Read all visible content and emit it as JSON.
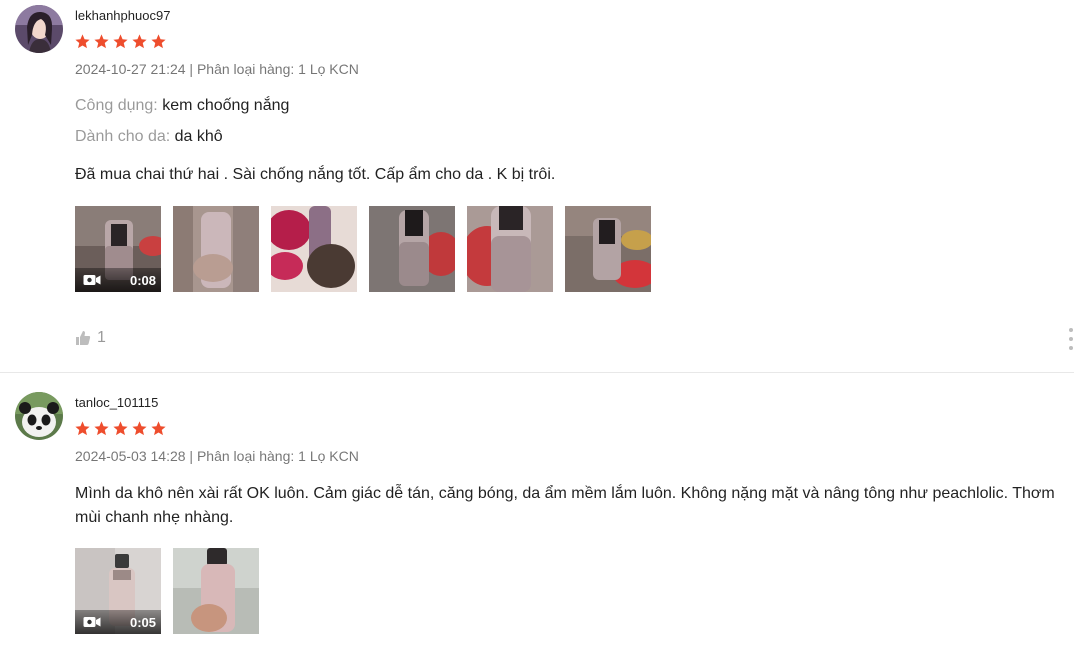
{
  "reviews": [
    {
      "username": "lekhanhphuoc97",
      "avatar_icon": "user-avatar-photo",
      "rating": 5,
      "datetime": "2024-10-27 21:24",
      "separator": " | ",
      "variation": "Phân loại hàng: 1 Lọ KCN",
      "attributes": [
        {
          "key": "Công dụng: ",
          "value": "kem choống nắng"
        },
        {
          "key": "Dành cho da: ",
          "value": "da khô"
        }
      ],
      "content": "Đã mua chai thứ hai . Sài chống nắng tốt. Cấp ẩm cho da . K bị trôi.",
      "video_duration": "0:08",
      "like_count": "1"
    },
    {
      "username": "tanloc_101115",
      "avatar_icon": "panda-avatar",
      "rating": 5,
      "datetime": "2024-05-03 14:28",
      "separator": " | ",
      "variation": "Phân loại hàng: 1 Lọ KCN",
      "content": "Mình da khô nên xài rất OK luôn. Cảm giác dễ tán, căng bóng, da ẩm mềm lắm luôn. Không nặng mặt và nâng tông như peachlolic. Thơm mùi chanh nhẹ nhàng.",
      "video_duration": "0:05"
    }
  ],
  "colors": {
    "star": "#ee4d2d",
    "muted": "#9e9e9e",
    "divider": "#e8e8e8"
  }
}
